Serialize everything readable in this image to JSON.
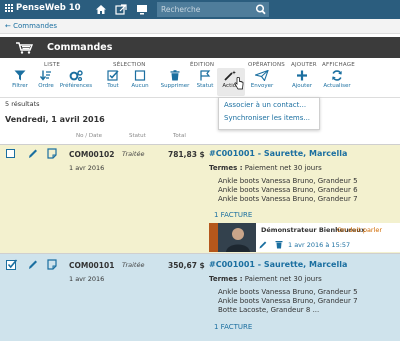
{
  "app": {
    "name": "PenseWeb 10"
  },
  "search": {
    "placeholder": "Recherche"
  },
  "breadcrumb": {
    "label": "Commandes"
  },
  "page": {
    "title": "Commandes"
  },
  "toolbar": {
    "groups": {
      "liste": "LISTE",
      "selection": "SÉLECTION",
      "edition": "ÉDITION",
      "operations": "OPÉRATIONS",
      "ajouter": "AJOUTER",
      "affichage": "AFFICHAGE"
    },
    "tools": {
      "filtrer": "Filtrer",
      "ordre": "Ordre",
      "preferences": "Préférences",
      "tout": "Tout",
      "aucun": "Aucun",
      "supprimer": "Supprimer",
      "statut": "Statut",
      "action": "Action",
      "envoyer": "Envoyer",
      "ajouter": "Ajouter",
      "actualiser": "Actualiser"
    }
  },
  "action_menu": {
    "items": [
      "Associer à un contact...",
      "Synchroniser les items..."
    ]
  },
  "results": "5 résultats",
  "date_group": "Vendredi, 1 avril 2016",
  "columns": {
    "no_date": "No / Date",
    "statut": "Statut",
    "total": "Total"
  },
  "rows": [
    {
      "code": "COM00102",
      "date": "1 avr 2016",
      "status": "Traitée",
      "total": "781,83 $",
      "client": "#C001001 - Saurette, Marcella",
      "terms_label": "Termes :",
      "terms_value": "Paiement net 30 jours",
      "items": [
        "Ankle boots Vanessa Bruno, Grandeur 5",
        "Ankle boots Vanessa Bruno, Grandeur 6",
        "Ankle boots Vanessa Bruno, Grandeur 7"
      ],
      "facture": "1 FACTURE",
      "comment": {
        "author": "Démonstrateur Bienheureux",
        "note": "On doit parler",
        "meta": "1 avr 2016 à 15:57"
      }
    },
    {
      "code": "COM00101",
      "date": "1 avr 2016",
      "status": "Traitée",
      "total": "350,67 $",
      "client": "#C001001 - Saurette, Marcella",
      "terms_label": "Termes :",
      "terms_value": "Paiement net 30 jours",
      "items": [
        "Ankle boots Vanessa Bruno, Grandeur 5",
        "Ankle boots Vanessa Bruno, Grandeur 7",
        "Botte Lacoste, Grandeur 8 ..."
      ],
      "facture": "1 FACTURE"
    }
  ],
  "colors": {
    "topbar": "#2b5d7e",
    "link": "#1b6fa0",
    "row_pending": "#f3f1cf",
    "row_selected": "#cfe3ec",
    "header": "#3b3b3b"
  }
}
